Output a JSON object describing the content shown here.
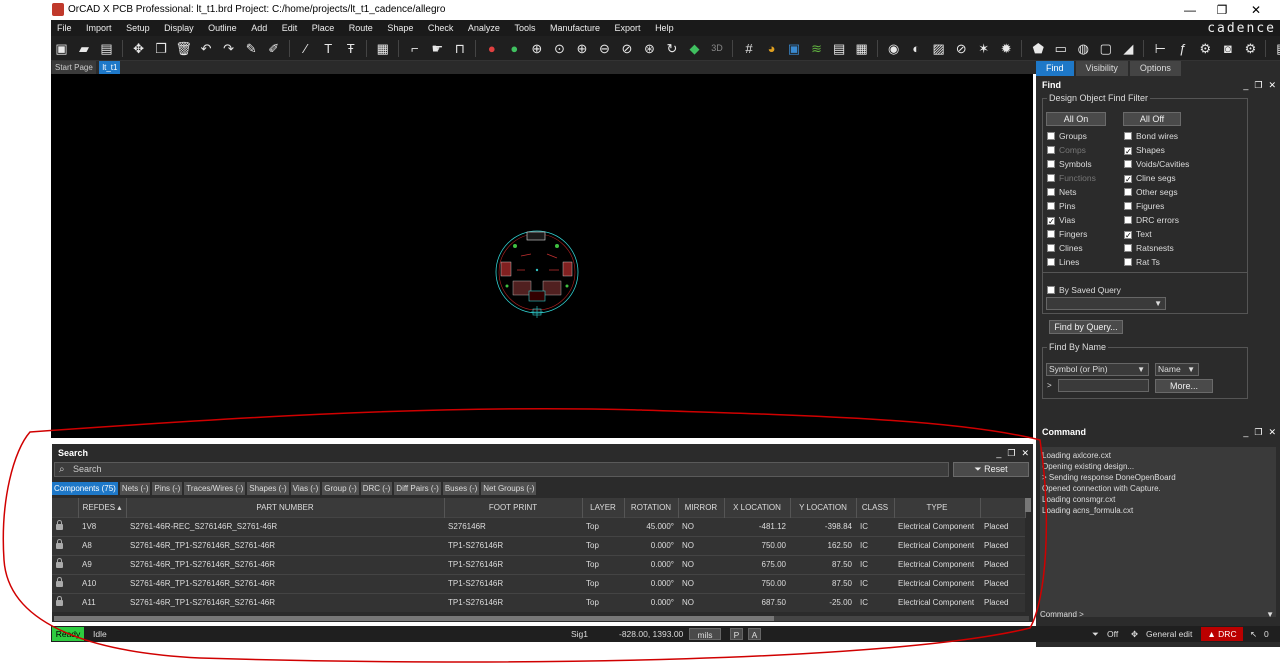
{
  "window": {
    "title": "OrCAD X PCB Professional: lt_t1.brd  Project: C:/home/projects/lt_t1_cadence/allegro",
    "minimize": "—",
    "maximize": "❐",
    "close": "✕"
  },
  "menu": {
    "items": [
      "File",
      "Import",
      "Setup",
      "Display",
      "Outline",
      "Add",
      "Edit",
      "Place",
      "Route",
      "Shape",
      "Check",
      "Analyze",
      "Tools",
      "Manufacture",
      "Export",
      "Help"
    ],
    "brand": "cadence"
  },
  "doc_tabs": {
    "start": "Start Page",
    "active": "lt_t1"
  },
  "right_panel": {
    "tabs": [
      "Find",
      "Visibility",
      "Options"
    ],
    "find_title": "Find",
    "filter_title": "Design Object Find Filter",
    "all_on": "All On",
    "all_off": "All Off",
    "left_checks": [
      {
        "label": "Groups",
        "checked": false,
        "disabled": false
      },
      {
        "label": "Comps",
        "checked": false,
        "disabled": true
      },
      {
        "label": "Symbols",
        "checked": false,
        "disabled": false
      },
      {
        "label": "Functions",
        "checked": false,
        "disabled": true
      },
      {
        "label": "Nets",
        "checked": false,
        "disabled": false
      },
      {
        "label": "Pins",
        "checked": false,
        "disabled": false
      },
      {
        "label": "Vias",
        "checked": true,
        "disabled": false
      },
      {
        "label": "Fingers",
        "checked": false,
        "disabled": false
      },
      {
        "label": "Clines",
        "checked": false,
        "disabled": false
      },
      {
        "label": "Lines",
        "checked": false,
        "disabled": false
      }
    ],
    "right_checks": [
      {
        "label": "Bond wires",
        "checked": false
      },
      {
        "label": "Shapes",
        "checked": true
      },
      {
        "label": "Voids/Cavities",
        "checked": false
      },
      {
        "label": "Cline segs",
        "checked": true
      },
      {
        "label": "Other segs",
        "checked": false
      },
      {
        "label": "Figures",
        "checked": false
      },
      {
        "label": "DRC errors",
        "checked": false
      },
      {
        "label": "Text",
        "checked": true
      },
      {
        "label": "Ratsnests",
        "checked": false
      },
      {
        "label": "Rat Ts",
        "checked": false
      }
    ],
    "by_saved_query": "By Saved Query",
    "find_by_query": "Find by Query...",
    "find_by_name_title": "Find By Name",
    "name_type": "Symbol (or Pin)",
    "name_mode": "Name",
    "prompt": ">",
    "more": "More..."
  },
  "command": {
    "title": "Command",
    "lines": [
      "Loading axlcore.cxt",
      "Opening existing design...",
      ">  Sending response DoneOpenBoard",
      "Opened connection with Capture.",
      "Loading consmgr.cxt",
      "Loading acns_formula.cxt"
    ],
    "input": "Command >"
  },
  "search": {
    "title": "Search",
    "placeholder": "Search",
    "reset": "Reset",
    "filter_tabs": [
      "Components (75)",
      "Nets (-)",
      "Pins (-)",
      "Traces/Wires (-)",
      "Shapes (-)",
      "Vias (-)",
      "Group (-)",
      "DRC (-)",
      "Diff Pairs (-)",
      "Buses (-)",
      "Net Groups (-)"
    ],
    "columns": [
      "",
      "REFDES ▴",
      "PART NUMBER",
      "FOOT PRINT",
      "LAYER",
      "ROTATION",
      "MIRROR",
      "X LOCATION",
      "Y LOCATION",
      "CLASS",
      "TYPE",
      ""
    ],
    "rows": [
      [
        "1V8",
        "S2761-46R-REC_S276146R_S2761-46R",
        "S276146R",
        "Top",
        "45.000°",
        "NO",
        "-481.12",
        "-398.84",
        "IC",
        "Electrical Component",
        "Placed"
      ],
      [
        "A8",
        "S2761-46R_TP1-S276146R_S2761-46R",
        "TP1-S276146R",
        "Top",
        "0.000°",
        "NO",
        "750.00",
        "162.50",
        "IC",
        "Electrical Component",
        "Placed"
      ],
      [
        "A9",
        "S2761-46R_TP1-S276146R_S2761-46R",
        "TP1-S276146R",
        "Top",
        "0.000°",
        "NO",
        "675.00",
        "87.50",
        "IC",
        "Electrical Component",
        "Placed"
      ],
      [
        "A10",
        "S2761-46R_TP1-S276146R_S2761-46R",
        "TP1-S276146R",
        "Top",
        "0.000°",
        "NO",
        "750.00",
        "87.50",
        "IC",
        "Electrical Component",
        "Placed"
      ],
      [
        "A11",
        "S2761-46R_TP1-S276146R_S2761-46R",
        "TP1-S276146R",
        "Top",
        "0.000°",
        "NO",
        "687.50",
        "-25.00",
        "IC",
        "Electrical Component",
        "Placed"
      ]
    ]
  },
  "status": {
    "ready": "Ready",
    "idle": "Idle",
    "layer": "Sig1",
    "coords": "-828.00, 1393.00",
    "units": "mils",
    "p": "P",
    "a": "A",
    "filter": "Off",
    "mode": "General edit",
    "drc": "DRC",
    "count": "0"
  },
  "colors": {
    "accent": "#1e78c8",
    "ready": "#2ecc40",
    "drc": "#bb0000",
    "annotation": "#d00000"
  }
}
